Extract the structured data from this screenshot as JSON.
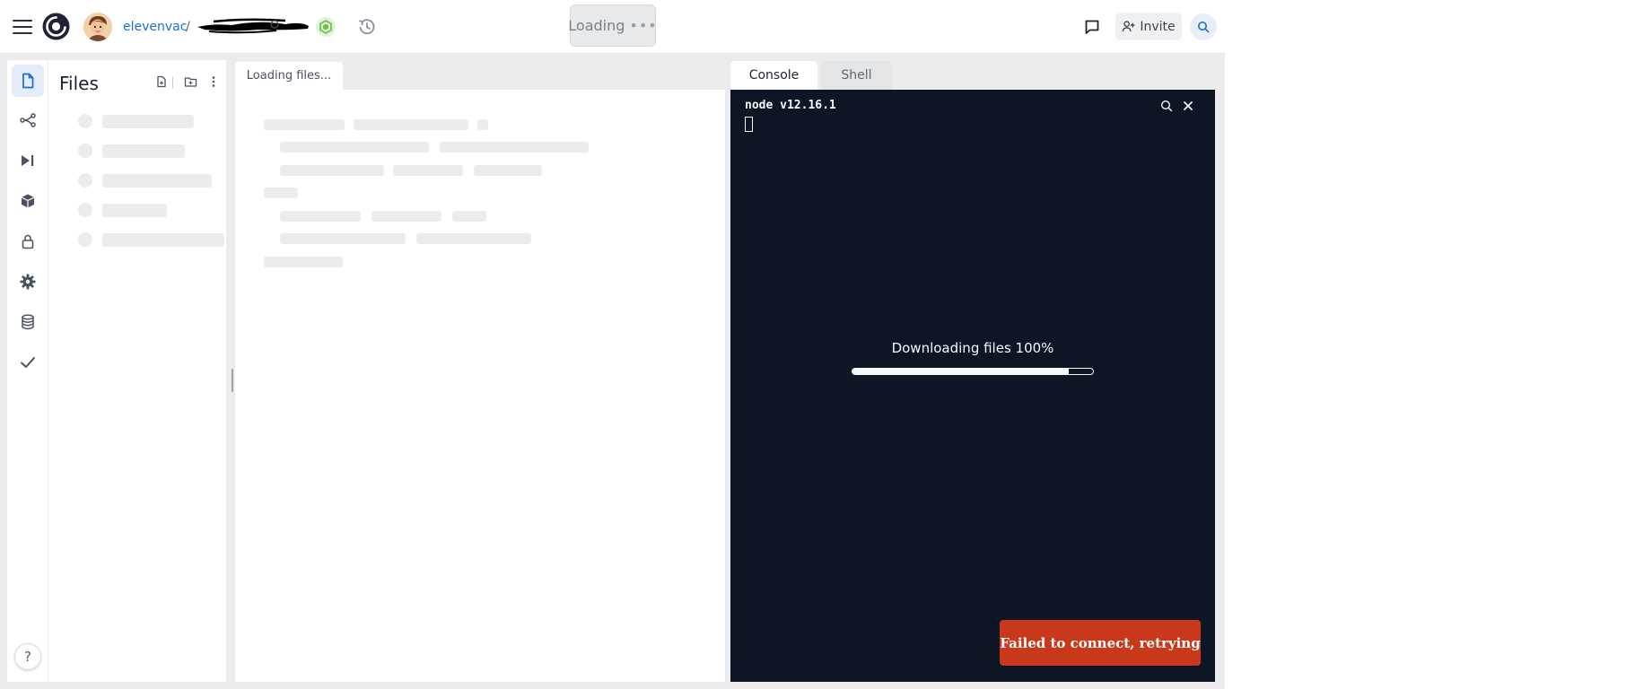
{
  "header": {
    "owner": "elevenvac",
    "separator": "/",
    "run_label": "Loading",
    "run_dots": "•••",
    "invite_label": "Invite"
  },
  "icons": {
    "menu": "hamburger-menu-icon",
    "logo": "replit-logo",
    "avatar": "user-avatar",
    "language": "nodejs-icon",
    "history": "history-icon",
    "comment": "comment-icon",
    "invite": "user-plus-icon",
    "search": "search-icon"
  },
  "sidebar": {
    "items": [
      {
        "name": "files",
        "icon": "file-icon",
        "active": true
      },
      {
        "name": "version-control",
        "icon": "git-branch-icon",
        "active": false
      },
      {
        "name": "debugger",
        "icon": "step-forward-icon",
        "active": false
      },
      {
        "name": "packages",
        "icon": "package-icon",
        "active": false
      },
      {
        "name": "secrets",
        "icon": "lock-icon",
        "active": false
      },
      {
        "name": "settings",
        "icon": "gear-icon",
        "active": false
      },
      {
        "name": "database",
        "icon": "database-icon",
        "active": false
      },
      {
        "name": "unit-tests",
        "icon": "check-icon",
        "active": false
      }
    ],
    "help_label": "?"
  },
  "files_panel": {
    "title": "Files",
    "actions": [
      "new-file-icon",
      "new-folder-icon",
      "more-options-icon"
    ]
  },
  "editor": {
    "tab_label": "Loading files..."
  },
  "console": {
    "tabs": [
      "Console",
      "Shell"
    ],
    "active_tab": "Console",
    "node_version": "node v12.16.1",
    "progress_label": "Downloading files 100%",
    "progress_value": 0.9,
    "error_message": "Failed to connect, retrying"
  },
  "colors": {
    "accent": "#1b6fd1",
    "console_bg": "#0e1525",
    "error": "#c8381a",
    "node_green": "#6cc24a"
  }
}
